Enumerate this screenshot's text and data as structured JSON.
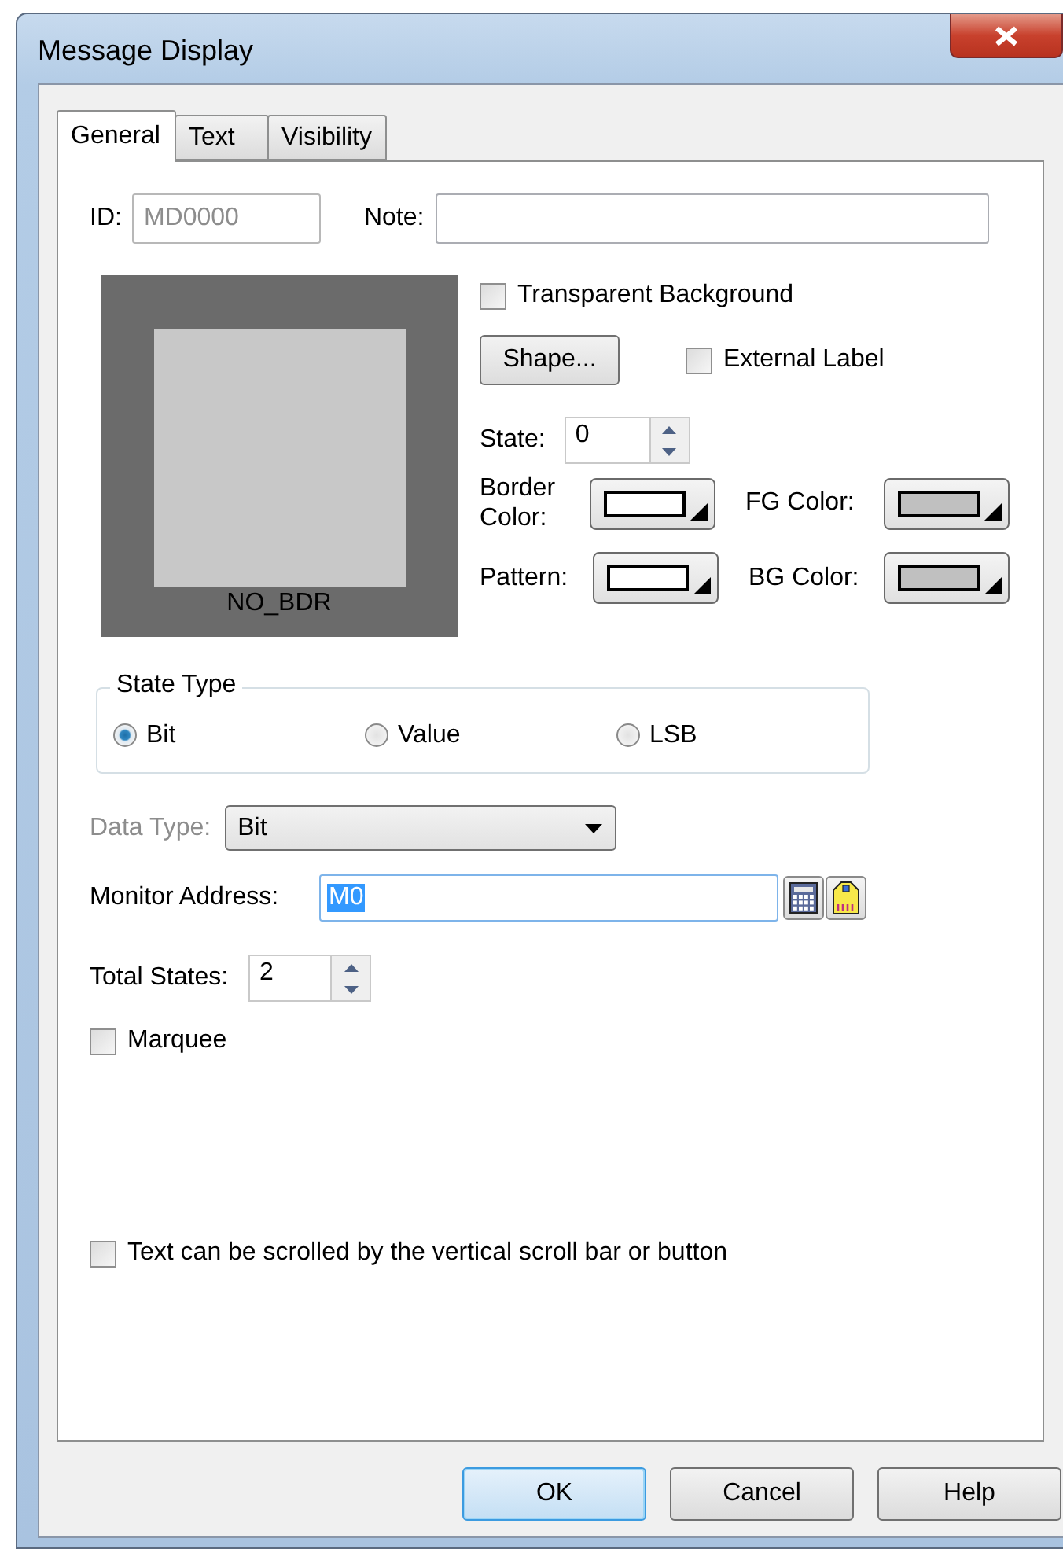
{
  "window": {
    "title": "Message Display"
  },
  "tabs": [
    {
      "label": "General",
      "selected": true
    },
    {
      "label": "Text",
      "selected": false
    },
    {
      "label": "Visibility",
      "selected": false
    }
  ],
  "id_field": {
    "label": "ID:",
    "value": "MD0000",
    "disabled": true
  },
  "note_field": {
    "label": "Note:"
  },
  "preview": {
    "caption": "NO_BDR"
  },
  "transparent_background": {
    "label": "Transparent Background",
    "checked": false
  },
  "shape_button": {
    "label": "Shape..."
  },
  "external_label": {
    "label": "External Label",
    "checked": false
  },
  "state": {
    "label": "State:",
    "value": "0"
  },
  "color_pickers": [
    {
      "label": "Border Color:",
      "color": "#ffffff"
    },
    {
      "label": "FG Color:",
      "color": "#c0c0c0"
    },
    {
      "label": "Pattern:",
      "color": "#ffffff"
    },
    {
      "label": "BG Color:",
      "color": "#c0c0c0"
    }
  ],
  "state_type": {
    "title": "State Type",
    "options": [
      {
        "label": "Bit",
        "selected": true
      },
      {
        "label": "Value",
        "selected": false
      },
      {
        "label": "LSB",
        "selected": false
      }
    ]
  },
  "data_type": {
    "label": "Data Type:",
    "value": "Bit",
    "disabled": true
  },
  "monitor_address": {
    "label": "Monitor Address:",
    "value": "M0"
  },
  "total_states": {
    "label": "Total States:",
    "value": "2"
  },
  "marquee": {
    "label": "Marquee",
    "checked": false
  },
  "scroll_text": {
    "label": "Text can be scrolled by the vertical scroll bar or button",
    "checked": false
  },
  "buttons": [
    {
      "label": "OK",
      "default": true
    },
    {
      "label": "Cancel",
      "default": false
    },
    {
      "label": "Help",
      "default": false
    }
  ]
}
